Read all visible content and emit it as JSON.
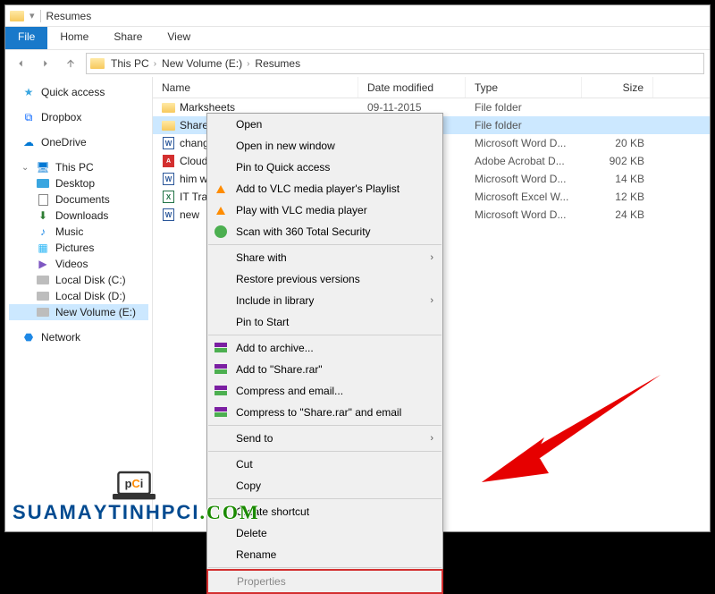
{
  "window": {
    "title": "Resumes"
  },
  "tabs": {
    "file": "File",
    "home": "Home",
    "share": "Share",
    "view": "View"
  },
  "breadcrumb": {
    "this_pc": "This PC",
    "volume": "New Volume (E:)",
    "folder": "Resumes"
  },
  "columns": {
    "name": "Name",
    "date": "Date modified",
    "type": "Type",
    "size": "Size"
  },
  "sidebar": {
    "quick_access": "Quick access",
    "dropbox": "Dropbox",
    "onedrive": "OneDrive",
    "this_pc": "This PC",
    "desktop": "Desktop",
    "documents": "Documents",
    "downloads": "Downloads",
    "music": "Music",
    "pictures": "Pictures",
    "videos": "Videos",
    "local_c": "Local Disk (C:)",
    "local_d": "Local Disk (D:)",
    "new_volume": "New Volume (E:)",
    "network": "Network"
  },
  "files": [
    {
      "name": "Marksheets",
      "date": "",
      "type": "File folder",
      "size": "",
      "icon": "folder"
    },
    {
      "name": "Share",
      "date": "",
      "type": "File folder",
      "size": "",
      "icon": "folder",
      "selected": true
    },
    {
      "name": "change…",
      "date": "",
      "type": "Microsoft Word D...",
      "size": "20 KB",
      "icon": "word"
    },
    {
      "name": "Cloud …",
      "date": "",
      "type": "Adobe Acrobat D...",
      "size": "902 KB",
      "icon": "pdf"
    },
    {
      "name": "him wr…",
      "date": "",
      "type": "Microsoft Word D...",
      "size": "14 KB",
      "icon": "word"
    },
    {
      "name": "IT Trai…",
      "date": "",
      "type": "Microsoft Excel W...",
      "size": "12 KB",
      "icon": "excel"
    },
    {
      "name": "new",
      "date": "",
      "type": "Microsoft Word D...",
      "size": "24 KB",
      "icon": "word"
    }
  ],
  "visible_date": "09-11-2015",
  "context_menu": {
    "open": "Open",
    "open_new": "Open in new window",
    "pin_quick": "Pin to Quick access",
    "vlc_add": "Add to VLC media player's Playlist",
    "vlc_play": "Play with VLC media player",
    "scan360": "Scan with 360 Total Security",
    "share_with": "Share with",
    "restore": "Restore previous versions",
    "include_lib": "Include in library",
    "pin_start": "Pin to Start",
    "add_archive": "Add to archive...",
    "add_rar": "Add to \"Share.rar\"",
    "compress_email": "Compress and email...",
    "compress_rar_email": "Compress to \"Share.rar\" and email",
    "send_to": "Send to",
    "cut": "Cut",
    "copy": "Copy",
    "create_shortcut": "Create shortcut",
    "delete": "Delete",
    "rename": "Rename",
    "properties": "Properties"
  },
  "watermark": "SUAMAYTINHPCI.COM"
}
